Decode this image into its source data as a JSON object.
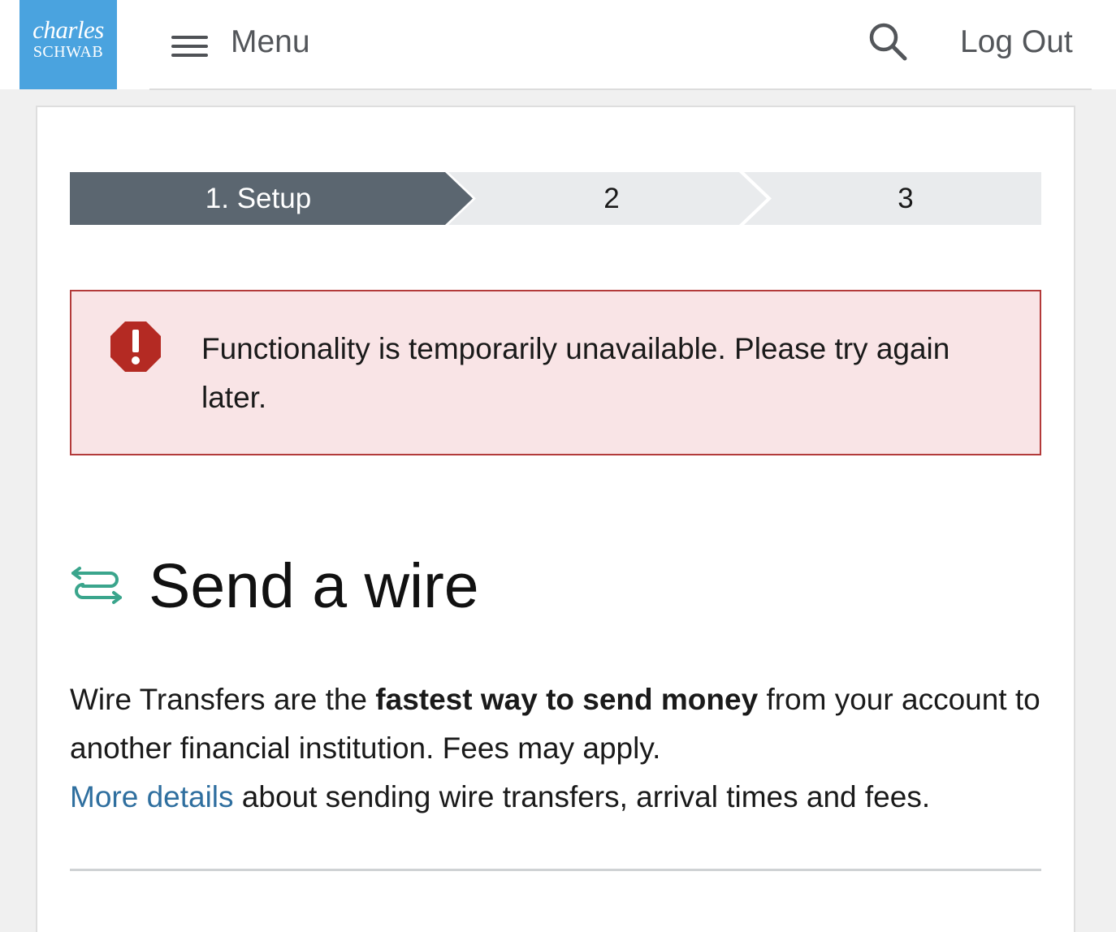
{
  "brand": {
    "logo_top": "charles",
    "logo_bottom": "SCHWAB",
    "color": "#4aa3df"
  },
  "header": {
    "menu_label": "Menu",
    "search_icon": "search-icon",
    "logout_label": "Log Out"
  },
  "stepper": {
    "steps": [
      {
        "label": "1. Setup",
        "active": true
      },
      {
        "label": "2",
        "active": false
      },
      {
        "label": "3",
        "active": false
      }
    ],
    "active_color": "#5b6670",
    "inactive_color": "#e9ebed"
  },
  "alert": {
    "icon": "error-octagon-icon",
    "message": "Functionality is temporarily unavailable. Please try again later.",
    "background": "#f9e4e6",
    "border": "#b33a3a"
  },
  "page": {
    "title_icon": "transfer-arrows-icon",
    "title": "Send a wire",
    "description": {
      "part1": "Wire Transfers are the ",
      "bold": "fastest way to send money",
      "part2": " from your account to another financial institution. Fees may apply.",
      "link": "More details",
      "part3": " about sending wire transfers, arrival times and fees."
    },
    "link_color": "#2f6f9f"
  }
}
